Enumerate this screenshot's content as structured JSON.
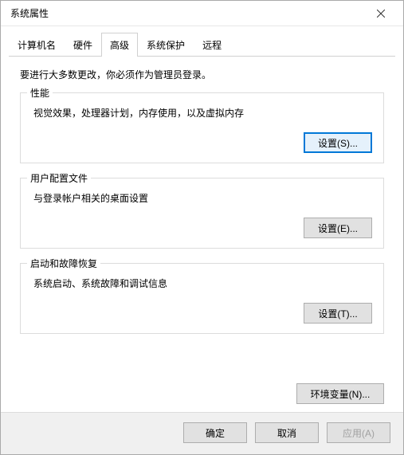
{
  "window": {
    "title": "系统属性"
  },
  "tabs": {
    "t0": "计算机名",
    "t1": "硬件",
    "t2": "高级",
    "t3": "系统保护",
    "t4": "远程"
  },
  "intro": "要进行大多数更改，你必须作为管理员登录。",
  "performance": {
    "title": "性能",
    "desc": "视觉效果，处理器计划，内存使用，以及虚拟内存",
    "button": "设置(S)..."
  },
  "userprofile": {
    "title": "用户配置文件",
    "desc": "与登录帐户相关的桌面设置",
    "button": "设置(E)..."
  },
  "startup": {
    "title": "启动和故障恢复",
    "desc": "系统启动、系统故障和调试信息",
    "button": "设置(T)..."
  },
  "env_button": "环境变量(N)...",
  "buttons": {
    "ok": "确定",
    "cancel": "取消",
    "apply": "应用(A)"
  }
}
